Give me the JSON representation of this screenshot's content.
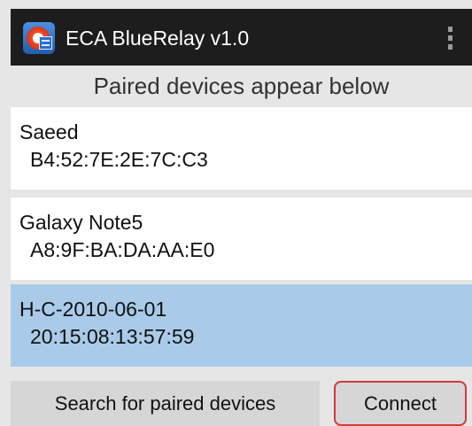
{
  "app_bar": {
    "title": "ECA BlueRelay v1.0",
    "icon": "app-logo-icon",
    "overflow_icon": "overflow-menu-icon"
  },
  "header": {
    "text": "Paired devices appear below"
  },
  "devices": [
    {
      "name": "Saeed",
      "address": "B4:52:7E:2E:7C:C3",
      "selected": false
    },
    {
      "name": "Galaxy Note5",
      "address": "A8:9F:BA:DA:AA:E0",
      "selected": false
    },
    {
      "name": "H-C-2010-06-01",
      "address": "20:15:08:13:57:59",
      "selected": true
    }
  ],
  "buttons": {
    "search_label": "Search for paired devices",
    "connect_label": "Connect"
  },
  "colors": {
    "action_bar": "#1d1d1d",
    "selected_row": "#a9cbe9",
    "connect_border": "#d23a3a",
    "background": "#e6e6e6"
  }
}
